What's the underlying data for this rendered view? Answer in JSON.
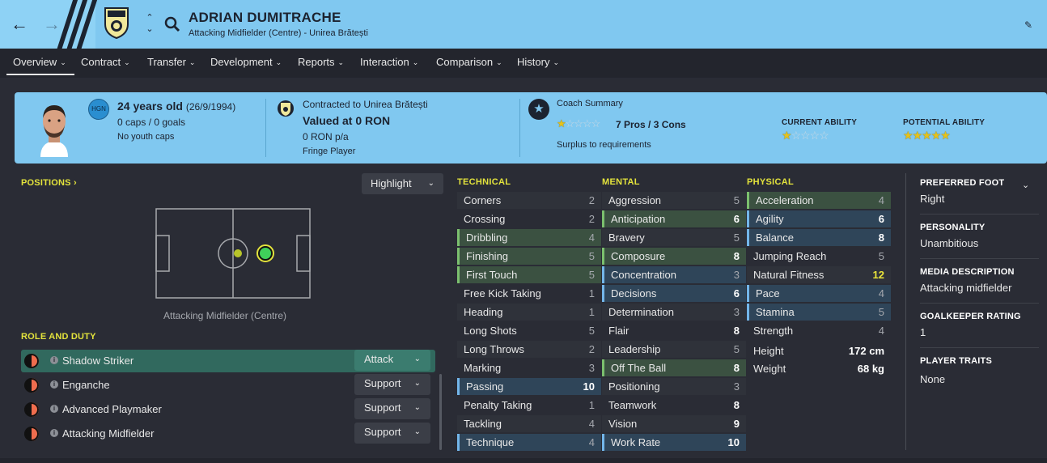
{
  "header": {
    "player_name": "ADRIAN DUMITRACHE",
    "subtitle": "Attacking Midfielder (Centre) - Unirea Brătești"
  },
  "menu": [
    {
      "label": "Overview",
      "active": true
    },
    {
      "label": "Contract"
    },
    {
      "label": "Transfer"
    },
    {
      "label": "Development"
    },
    {
      "label": "Reports"
    },
    {
      "label": "Interaction"
    },
    {
      "label": "Comparison"
    },
    {
      "label": "History"
    }
  ],
  "summary": {
    "nationality_code": "HGN",
    "age": "24 years old",
    "dob": "(26/9/1994)",
    "caps": "0 caps / 0 goals",
    "youth_caps": "No youth caps",
    "contract": "Contracted to Unirea Brătești",
    "value": "Valued at 0 RON",
    "wage": "0 RON p/a",
    "squad_status": "Fringe Player",
    "coach_title": "Coach Summary",
    "coach_stars": 0.5,
    "pros_cons": "7 Pros / 3 Cons",
    "coach_note": "Surplus to requirements",
    "current_ability_label": "CURRENT ABILITY",
    "current_ability_stars": 0.5,
    "potential_ability_label": "POTENTIAL ABILITY",
    "potential_ability_stars": 5
  },
  "positions": {
    "title": "POSITIONS",
    "highlight_label": "Highlight",
    "position_label": "Attacking Midfielder (Centre)",
    "role_title": "ROLE AND DUTY",
    "roles": [
      {
        "name": "Shadow Striker",
        "duty": "Attack",
        "active": true
      },
      {
        "name": "Enganche",
        "duty": "Support"
      },
      {
        "name": "Advanced Playmaker",
        "duty": "Support"
      },
      {
        "name": "Attacking Midfielder",
        "duty": "Support"
      }
    ]
  },
  "attributes": {
    "technical_title": "TECHNICAL",
    "technical": [
      {
        "name": "Corners",
        "value": "2"
      },
      {
        "name": "Crossing",
        "value": "2"
      },
      {
        "name": "Dribbling",
        "value": "4",
        "style": "good"
      },
      {
        "name": "Finishing",
        "value": "5",
        "style": "good"
      },
      {
        "name": "First Touch",
        "value": "5",
        "style": "good"
      },
      {
        "name": "Free Kick Taking",
        "value": "1"
      },
      {
        "name": "Heading",
        "value": "1"
      },
      {
        "name": "Long Shots",
        "value": "5"
      },
      {
        "name": "Long Throws",
        "value": "2"
      },
      {
        "name": "Marking",
        "value": "3"
      },
      {
        "name": "Passing",
        "value": "10",
        "style": "key"
      },
      {
        "name": "Penalty Taking",
        "value": "1"
      },
      {
        "name": "Tackling",
        "value": "4"
      },
      {
        "name": "Technique",
        "value": "4",
        "style": "key"
      }
    ],
    "mental_title": "MENTAL",
    "mental": [
      {
        "name": "Aggression",
        "value": "5"
      },
      {
        "name": "Anticipation",
        "value": "6",
        "style": "good"
      },
      {
        "name": "Bravery",
        "value": "5"
      },
      {
        "name": "Composure",
        "value": "8",
        "style": "good"
      },
      {
        "name": "Concentration",
        "value": "3",
        "style": "key"
      },
      {
        "name": "Decisions",
        "value": "6",
        "style": "key"
      },
      {
        "name": "Determination",
        "value": "3"
      },
      {
        "name": "Flair",
        "value": "8"
      },
      {
        "name": "Leadership",
        "value": "5"
      },
      {
        "name": "Off The Ball",
        "value": "8",
        "style": "good"
      },
      {
        "name": "Positioning",
        "value": "3"
      },
      {
        "name": "Teamwork",
        "value": "8"
      },
      {
        "name": "Vision",
        "value": "9"
      },
      {
        "name": "Work Rate",
        "value": "10",
        "style": "key"
      }
    ],
    "physical_title": "PHYSICAL",
    "physical": [
      {
        "name": "Acceleration",
        "value": "4",
        "style": "good"
      },
      {
        "name": "Agility",
        "value": "6",
        "style": "key"
      },
      {
        "name": "Balance",
        "value": "8",
        "style": "key"
      },
      {
        "name": "Jumping Reach",
        "value": "5"
      },
      {
        "name": "Natural Fitness",
        "value": "12"
      },
      {
        "name": "Pace",
        "value": "4",
        "style": "key"
      },
      {
        "name": "Stamina",
        "value": "5",
        "style": "key"
      },
      {
        "name": "Strength",
        "value": "4"
      }
    ],
    "height_label": "Height",
    "height": "172 cm",
    "weight_label": "Weight",
    "weight": "68 kg"
  },
  "info": {
    "preferred_foot_title": "PREFERRED FOOT",
    "preferred_foot": "Right",
    "personality_title": "PERSONALITY",
    "personality": "Unambitious",
    "media_title": "MEDIA DESCRIPTION",
    "media": "Attacking midfielder",
    "gk_title": "GOALKEEPER RATING",
    "gk": "1",
    "traits_title": "PLAYER TRAITS",
    "traits": "None"
  },
  "colors": {
    "accent_blue": "#80c8f0",
    "section_yellow": "#e3e33c",
    "active_role_green": "#31695e",
    "background": "#2a2c35"
  }
}
